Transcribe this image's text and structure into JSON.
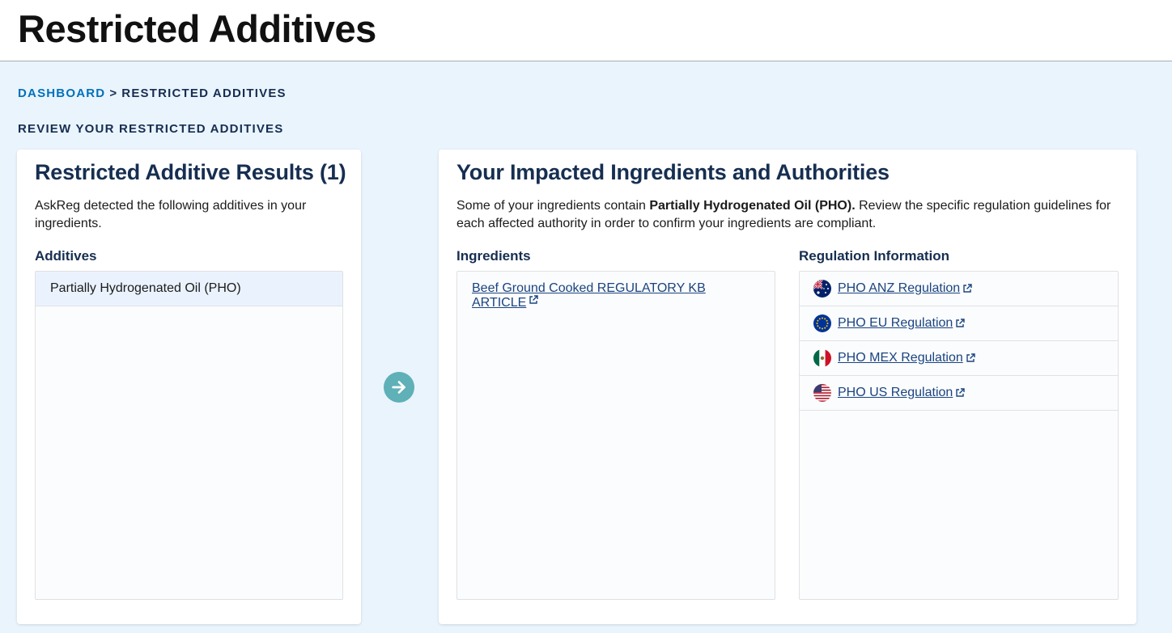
{
  "header": {
    "title": "Restricted Additives"
  },
  "breadcrumb": {
    "dashboard": "Dashboard",
    "separator": ">",
    "current": "Restricted Additives"
  },
  "section_label": "Review Your Restricted Additives",
  "left_card": {
    "title": "Restricted Additive Results (1)",
    "description": "AskReg detected the following additives in your ingredients.",
    "additives_label": "Additives",
    "additives": [
      "Partially Hydrogenated Oil (PHO)"
    ]
  },
  "right_card": {
    "title": "Your Impacted Ingredients and Authorities",
    "desc_prefix": "Some of your ingredients contain ",
    "desc_bold": "Partially Hydrogenated Oil (PHO).",
    "desc_suffix": " Review the specific regulation guidelines for each affected authority in order to confirm your ingredients are compliant.",
    "ingredients_label": "Ingredients",
    "ingredients": [
      "Beef Ground Cooked REGULATORY KB ARTICLE"
    ],
    "regulation_label": "Regulation Information",
    "regulations": [
      {
        "label": "PHO ANZ Regulation",
        "flag": "australia-flag-icon"
      },
      {
        "label": "PHO EU Regulation",
        "flag": "eu-flag-icon"
      },
      {
        "label": "PHO MEX Regulation",
        "flag": "mexico-flag-icon"
      },
      {
        "label": "PHO US Regulation",
        "flag": "us-flag-icon"
      }
    ]
  },
  "icons": {
    "arrow": "arrow-right-circle-icon",
    "external": "external-link-icon"
  },
  "colors": {
    "page_bg": "#eaf4fd",
    "link": "#1a4480",
    "breadcrumb_link": "#0071bc",
    "heading": "#162e51",
    "arrow_bg": "#5fb0b7"
  }
}
